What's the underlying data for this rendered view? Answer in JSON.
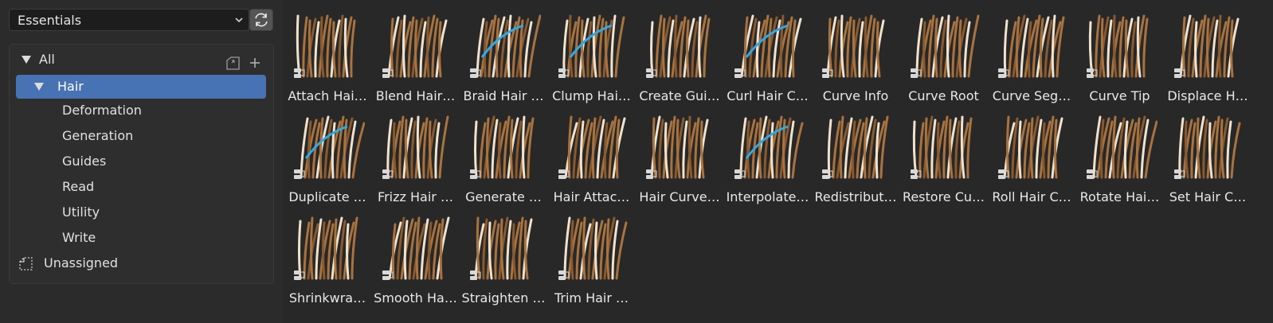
{
  "library": {
    "selected": "Essentials"
  },
  "tree": {
    "root": "All",
    "items": [
      {
        "label": "Hair"
      },
      {
        "label": "Deformation"
      },
      {
        "label": "Generation"
      },
      {
        "label": "Guides"
      },
      {
        "label": "Read"
      },
      {
        "label": "Utility"
      },
      {
        "label": "Write"
      }
    ],
    "unassigned": "Unassigned"
  },
  "assets": [
    "Attach Hai…",
    "Blend Hair…",
    "Braid Hair …",
    "Clump Hai…",
    "Create Gui…",
    "Curl Hair C…",
    "Curve Info",
    "Curve Root",
    "Curve Seg…",
    "Curve Tip",
    "Displace H…",
    "Duplicate …",
    "Frizz Hair …",
    "Generate …",
    "Hair Attac…",
    "Hair Curve…",
    "Interpolate…",
    "Redistribut…",
    "Restore Cu…",
    "Roll Hair C…",
    "Rotate Hai…",
    "Set Hair C…",
    "Shrinkwra…",
    "Smooth Ha…",
    "Straighten …",
    "Trim Hair …"
  ],
  "colors": {
    "selected": "#4772b3",
    "hair": "#a8733f",
    "accent": "#2fa8e6"
  }
}
